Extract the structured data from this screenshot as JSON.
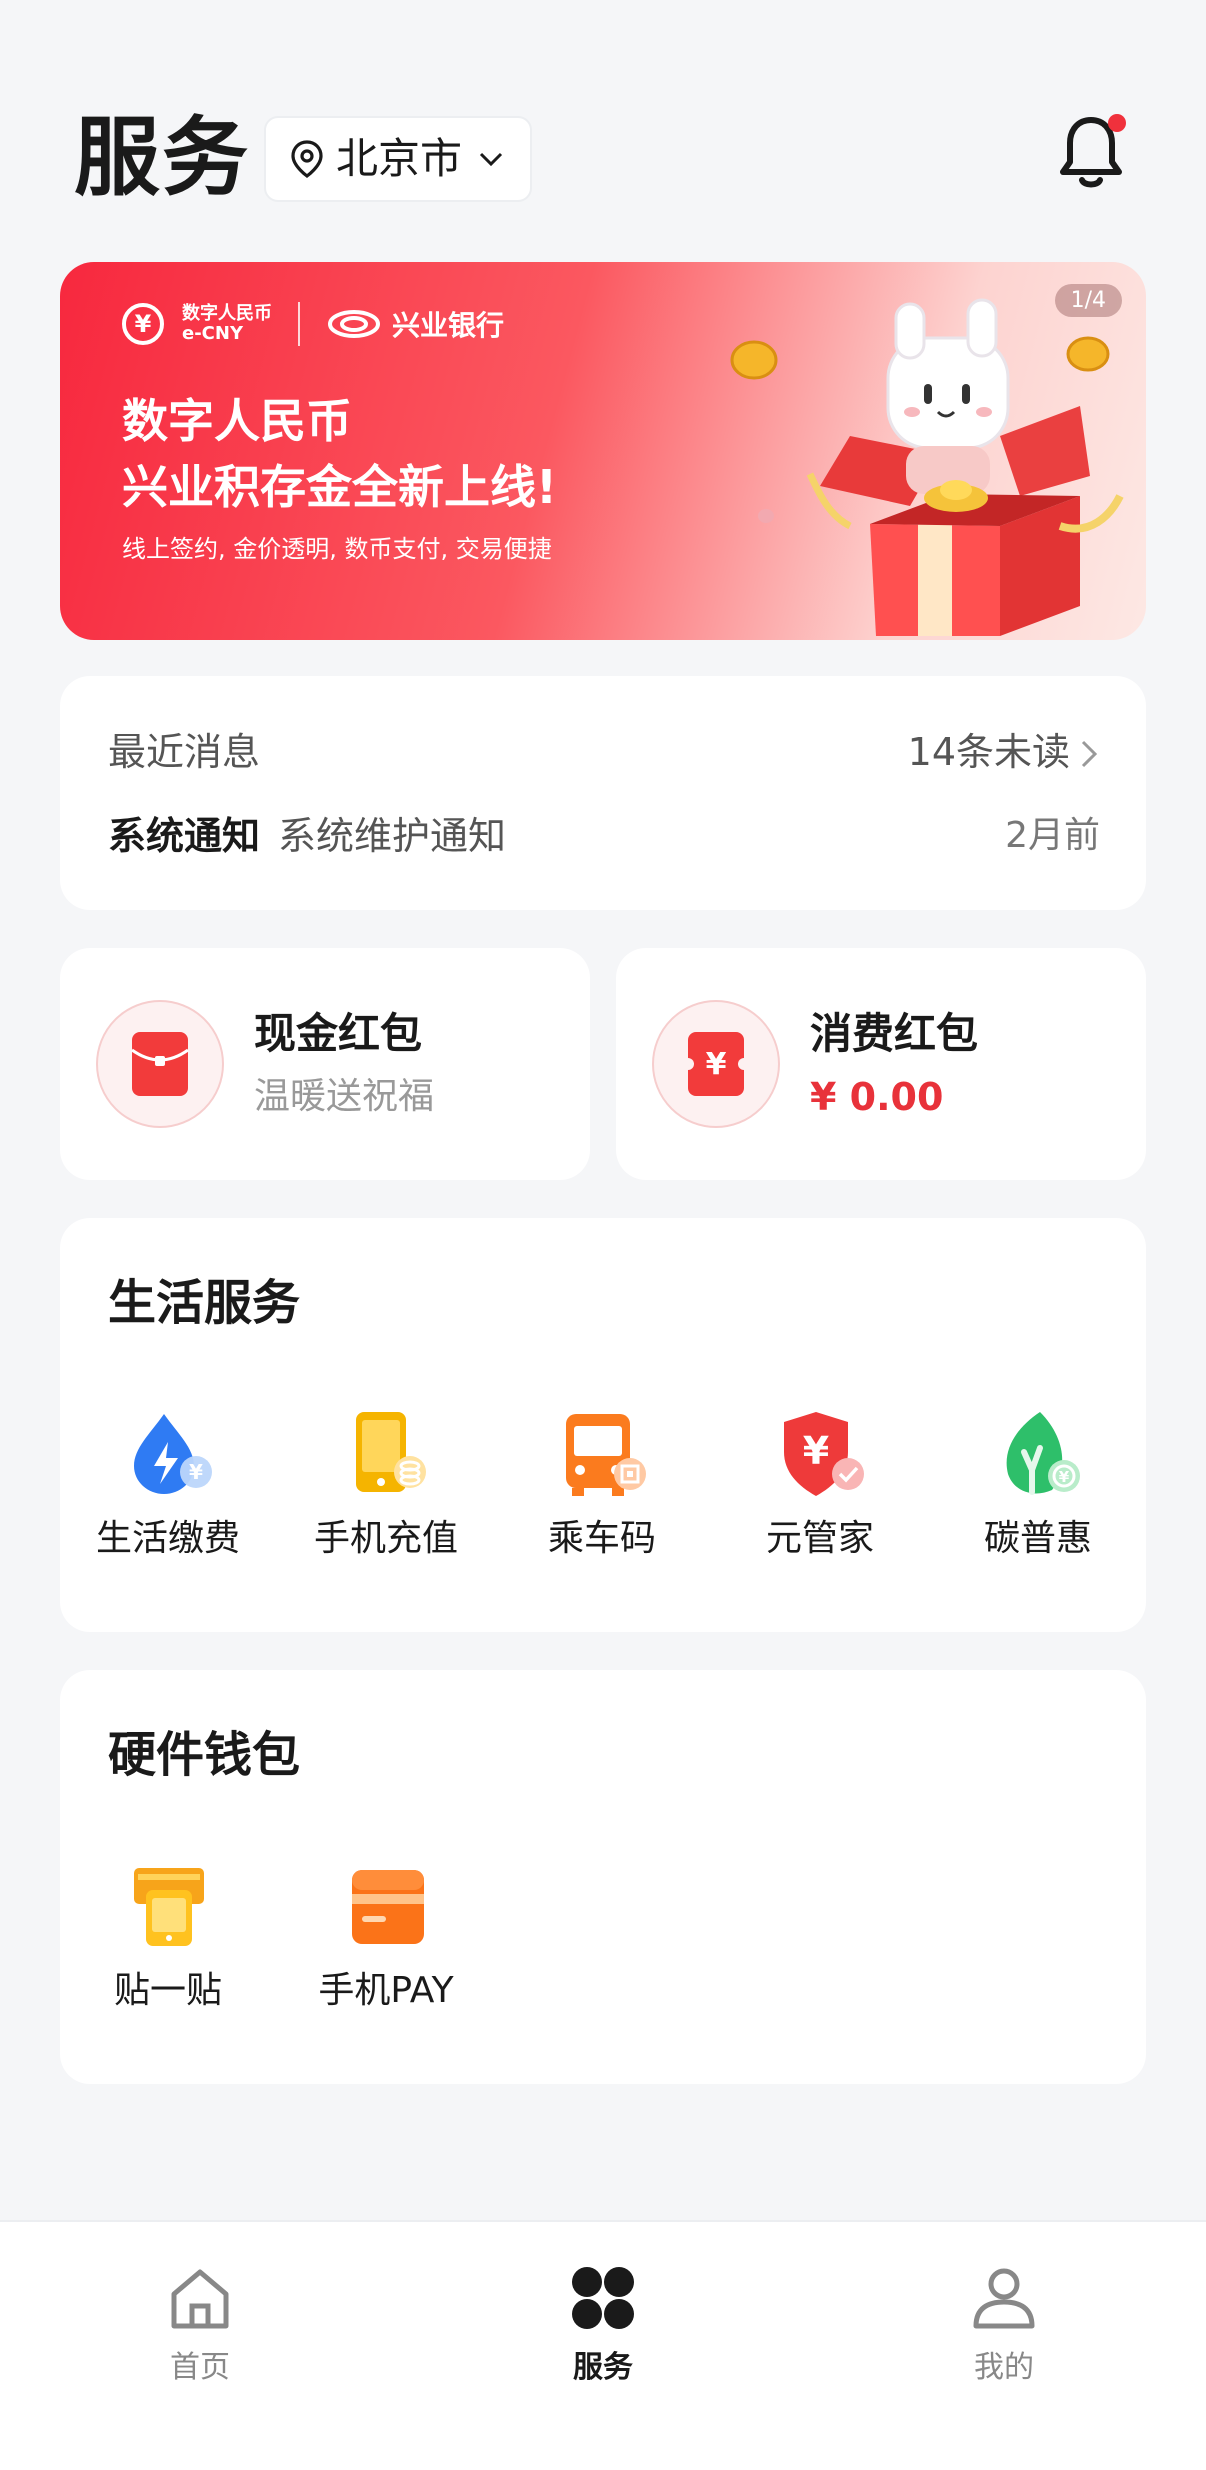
{
  "header": {
    "title": "服务",
    "city": "北京市"
  },
  "banner": {
    "brand_a_line1": "数字人民币",
    "brand_a_line2": "e-CNY",
    "brand_b": "兴业银行",
    "headline_line1": "数字人民币",
    "headline_line2": "兴业积存金全新上线!",
    "subtitle": "线上签约, 金价透明, 数币支付, 交易便捷",
    "pager": "1/4"
  },
  "messages": {
    "title": "最近消息",
    "unread": "14条未读",
    "type": "系统通知",
    "text": "系统维护通知",
    "time": "2月前"
  },
  "red_packets": {
    "cash": {
      "title": "现金红包",
      "desc": "温暖送祝福"
    },
    "consume": {
      "title": "消费红包",
      "amount": "¥ 0.00"
    }
  },
  "life_services": {
    "title": "生活服务",
    "items": [
      {
        "label": "生活缴费",
        "icon": "water-bolt-icon"
      },
      {
        "label": "手机充值",
        "icon": "phone-recharge-icon"
      },
      {
        "label": "乘车码",
        "icon": "bus-icon"
      },
      {
        "label": "元管家",
        "icon": "shield-yuan-icon"
      },
      {
        "label": "碳普惠",
        "icon": "leaf-icon"
      }
    ]
  },
  "hardware_wallet": {
    "title": "硬件钱包",
    "items": [
      {
        "label": "贴一贴",
        "icon": "tap-card-icon"
      },
      {
        "label": "手机PAY",
        "icon": "card-icon"
      }
    ]
  },
  "tabbar": {
    "items": [
      {
        "label": "首页",
        "icon": "home-icon",
        "active": false
      },
      {
        "label": "服务",
        "icon": "services-grid-icon",
        "active": true
      },
      {
        "label": "我的",
        "icon": "profile-icon",
        "active": false
      }
    ]
  },
  "colors": {
    "accent_red": "#f0313c",
    "background": "#f5f6f8"
  }
}
